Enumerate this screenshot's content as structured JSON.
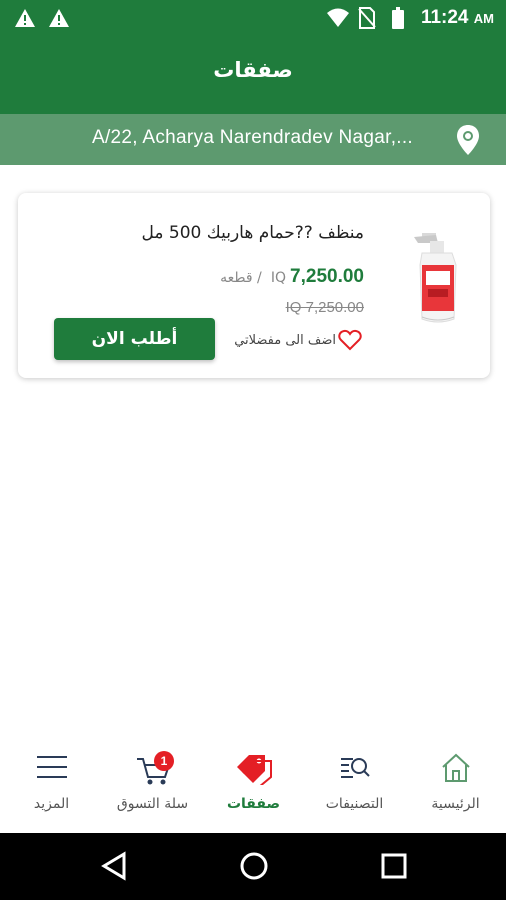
{
  "status_bar": {
    "time": "11:24",
    "ampm": "AM"
  },
  "header": {
    "title": "صفقات"
  },
  "address_bar": {
    "address": "A/22, Acharya Narendradev Nagar,..."
  },
  "product": {
    "name": "منظف ??حمام هاربيك 500 مل",
    "price": "7,250.00",
    "currency": "IQ",
    "unit": "/ قطعه",
    "old_price": "IQ 7,250.00",
    "favorite_label": "اضف الى مفضلاتي",
    "order_button": "أطلب الان"
  },
  "bottom_nav": {
    "home": "الرئيسية",
    "categories": "التصنيفات",
    "deals": "صفقات",
    "cart": "سلة التسوق",
    "cart_count": "1",
    "more": "المزيد"
  },
  "colors": {
    "primary": "#1f7c3c",
    "address_bg": "#5d9a6f",
    "accent_red": "#e41f25"
  }
}
